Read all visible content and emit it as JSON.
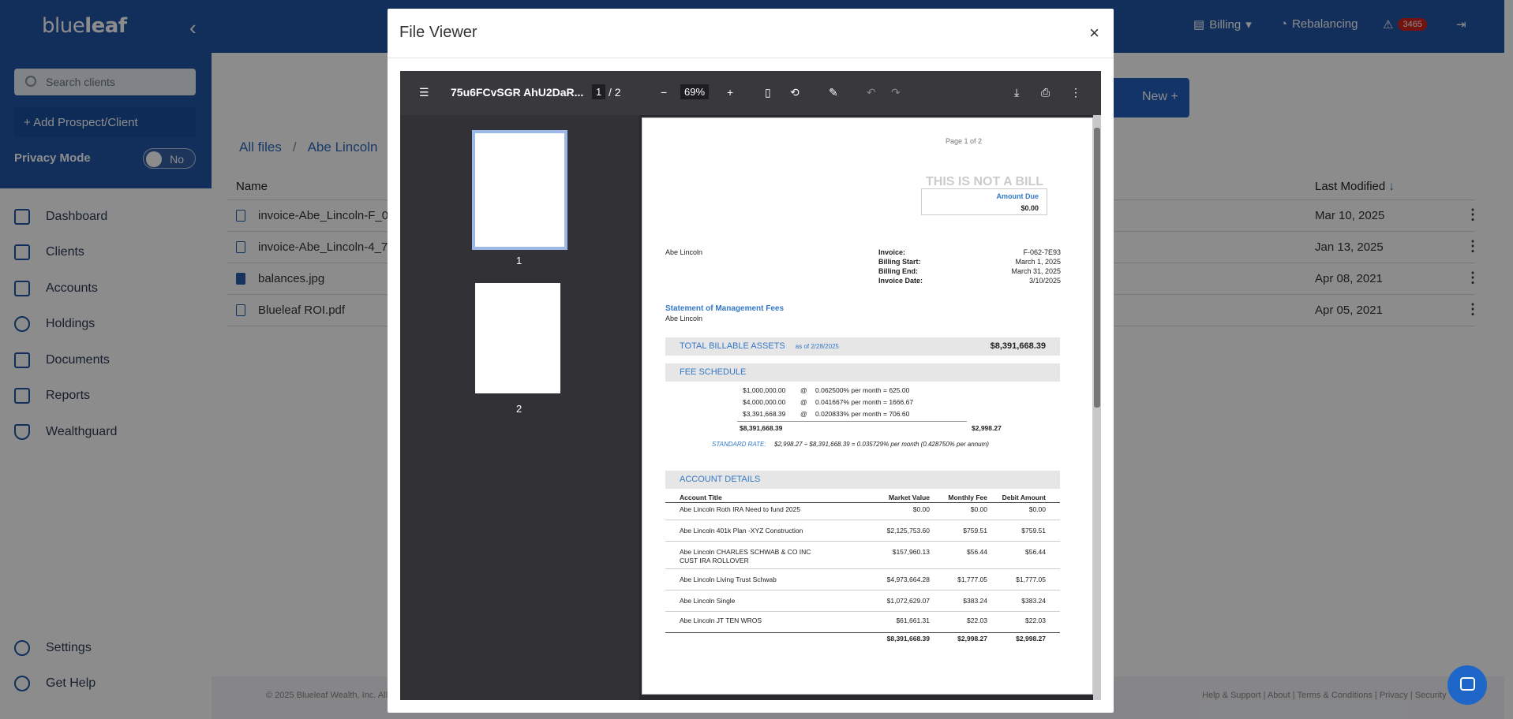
{
  "app": {
    "logo_light": "blue",
    "logo_bold": "leaf"
  },
  "topbar": {
    "billing": "Billing",
    "rebalancing": "Rebalancing",
    "alert_count": "3465"
  },
  "sidebar": {
    "search_placeholder": "Search clients",
    "add_client": "Add Prospect/Client",
    "privacy_mode": "Privacy Mode",
    "privacy_value": "No",
    "items": [
      {
        "label": "Dashboard",
        "icon": "grid-icon"
      },
      {
        "label": "Clients",
        "icon": "users-icon"
      },
      {
        "label": "Accounts",
        "icon": "bank-icon"
      },
      {
        "label": "Holdings",
        "icon": "pie-chart-icon"
      },
      {
        "label": "Documents",
        "icon": "folder-icon"
      },
      {
        "label": "Reports",
        "icon": "bar-chart-icon"
      },
      {
        "label": "Wealthguard",
        "icon": "shield-icon"
      }
    ],
    "settings": "Settings",
    "help": "Get Help"
  },
  "main": {
    "breadcrumb": [
      "All files",
      "Abe Lincoln"
    ],
    "new_button": "New +",
    "columns": {
      "name": "Name",
      "modified": "Last Modified"
    },
    "files": [
      {
        "name": "invoice-Abe_Lincoln-F_0",
        "modified": "Mar 10, 2025"
      },
      {
        "name": "invoice-Abe_Lincoln-4_7",
        "modified": "Jan 13, 2025"
      },
      {
        "name": "balances.jpg",
        "modified": "Apr 08, 2021"
      },
      {
        "name": "Blueleaf ROI.pdf",
        "modified": "Apr 05, 2021"
      }
    ],
    "footer_left": "© 2025 Blueleaf Wealth, Inc. All",
    "footer_right": "Help & Support | About | Terms & Conditions | Privacy | Security"
  },
  "modal": {
    "title": "File Viewer",
    "close": "×",
    "pdf": {
      "filename": "75u6FCvSGR AhU2DaR...",
      "page_current": "1",
      "page_total": "/ 2",
      "zoom": "69%",
      "thumb_labels": [
        "1",
        "2"
      ],
      "page": {
        "page_of": "Page 1 of 2",
        "not_bill": "THIS IS NOT A BILL",
        "amount_due_label": "Amount Due",
        "amount_due": "$0.00",
        "client": "Abe Lincoln",
        "invoice_fields": [
          {
            "label": "Invoice:",
            "value": "F-062-7E93"
          },
          {
            "label": "Billing Start:",
            "value": "March 1, 2025"
          },
          {
            "label": "Billing End:",
            "value": "March 31, 2025"
          },
          {
            "label": "Invoice Date:",
            "value": "3/10/2025"
          }
        ],
        "statement_title": "Statement of Management Fees",
        "statement_client": "Abe Lincoln",
        "tba_label": "TOTAL BILLABLE ASSETS",
        "tba_asof": "as of 2/28/2025",
        "tba_value": "$8,391,668.39",
        "fee_schedule": "FEE SCHEDULE",
        "fee_rows": [
          {
            "amount": "$1,000,000.00",
            "at": "@",
            "rate": "0.062500% per month = 625.00"
          },
          {
            "amount": "$4,000,000.00",
            "at": "@",
            "rate": "0.041667% per month = 1666.67"
          },
          {
            "amount": "$3,391,668.39",
            "at": "@",
            "rate": "0.020833% per month = 706.60"
          }
        ],
        "fee_total_assets": "$8,391,668.39",
        "fee_total": "$2,998.27",
        "std_rate_label": "STANDARD RATE:",
        "std_rate_text": "$2,998.27 ÷ $8,391,668.39 = 0.035729% per month (0.428750% per annum)",
        "account_details": "ACCOUNT DETAILS",
        "acct_cols": [
          "Account Title",
          "Market Value",
          "Monthly Fee",
          "Debit Amount"
        ],
        "accounts": [
          {
            "title": "Abe Lincoln Roth IRA Need to fund 2025",
            "mv": "$0.00",
            "fee": "$0.00",
            "debit": "$0.00"
          },
          {
            "title": "Abe Lincoln 401k Plan -XYZ Construction",
            "mv": "$2,125,753.60",
            "fee": "$759.51",
            "debit": "$759.51"
          },
          {
            "title": "Abe Lincoln CHARLES SCHWAB & CO INC",
            "title2": "CUST IRA ROLLOVER",
            "mv": "$157,960.13",
            "fee": "$56.44",
            "debit": "$56.44"
          },
          {
            "title": "Abe Lincoln Living Trust Schwab",
            "mv": "$4,973,664.28",
            "fee": "$1,777.05",
            "debit": "$1,777.05"
          },
          {
            "title": "Abe Lincoln Single",
            "mv": "$1,072,629.07",
            "fee": "$383.24",
            "debit": "$383.24"
          },
          {
            "title": "Abe Lincoln JT TEN WROS",
            "mv": "$61,661.31",
            "fee": "$22.03",
            "debit": "$22.03"
          }
        ],
        "acct_totals": {
          "mv": "$8,391,668.39",
          "fee": "$2,998.27",
          "debit": "$2,998.27"
        }
      }
    }
  }
}
